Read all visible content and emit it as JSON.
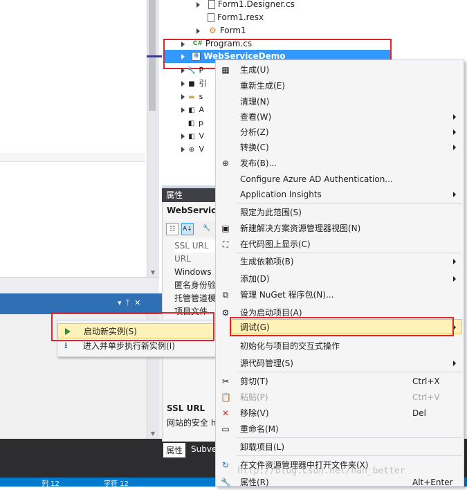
{
  "solution_explorer": {
    "files": [
      {
        "name": "Form1.Designer.cs",
        "icon": "cs-file-icon"
      },
      {
        "name": "Form1.resx",
        "icon": "resx-file-icon"
      },
      {
        "name": "Form1",
        "icon": "form-icon"
      },
      {
        "name": "Program.cs",
        "icon": "csharp-icon"
      }
    ],
    "project": "WebServiceDemo",
    "project_children_visible": [
      "P",
      "引",
      "s",
      "A",
      "p",
      "V",
      "V"
    ]
  },
  "properties": {
    "title": "属性",
    "object_name": "WebService",
    "rows": [
      "SSL URL",
      "URL",
      "Windows",
      "匿名身份验",
      "托管管道模",
      "项目文件"
    ],
    "desc_title": "SSL URL",
    "desc_text": "网站的安全 h",
    "tabs": [
      "属性",
      "Subve"
    ]
  },
  "submenu": {
    "items": [
      "启动新实例(S)",
      "进入并单步执行新实例(I)"
    ]
  },
  "context_menu": {
    "items": [
      {
        "label": "生成(U)"
      },
      {
        "label": "重新生成(E)"
      },
      {
        "label": "清理(N)"
      },
      {
        "label": "查看(W)",
        "arrow": true
      },
      {
        "label": "分析(Z)",
        "arrow": true
      },
      {
        "label": "转换(C)",
        "arrow": true
      },
      {
        "label": "发布(B)..."
      },
      {
        "label": "Configure Azure AD Authentication..."
      },
      {
        "label": "Application Insights",
        "arrow": true
      },
      {
        "label": "限定为此范围(S)"
      },
      {
        "label": "新建解决方案资源管理器视图(N)"
      },
      {
        "label": "在代码图上显示(C)"
      },
      {
        "label": "生成依赖项(B)",
        "arrow": true
      },
      {
        "label": "添加(D)",
        "arrow": true
      },
      {
        "label": "管理 NuGet 程序包(N)..."
      },
      {
        "label": "设为启动项目(A)"
      },
      {
        "label": "调试(G)",
        "arrow": true
      },
      {
        "label": "初始化与项目的交互式操作"
      },
      {
        "label": "源代码管理(S)",
        "arrow": true
      },
      {
        "label": "剪切(T)",
        "shortcut": "Ctrl+X"
      },
      {
        "label": "粘贴(P)",
        "shortcut": "Ctrl+V"
      },
      {
        "label": "移除(V)",
        "shortcut": "Del"
      },
      {
        "label": "重命名(M)"
      },
      {
        "label": "卸载项目(L)"
      },
      {
        "label": "在文件资源管理器中打开文件夹(X)"
      },
      {
        "label": "属性(R)",
        "shortcut": "Alt+Enter"
      }
    ]
  },
  "status_bar": {
    "left1": "列 12",
    "left2": "字符 12"
  },
  "watermark": "http://blog.csdn.net/han_better",
  "colors": {
    "accent": "#007acc",
    "highlight": "#fff2b8",
    "selection": "#3399ff",
    "annotation": "#e0262a"
  }
}
